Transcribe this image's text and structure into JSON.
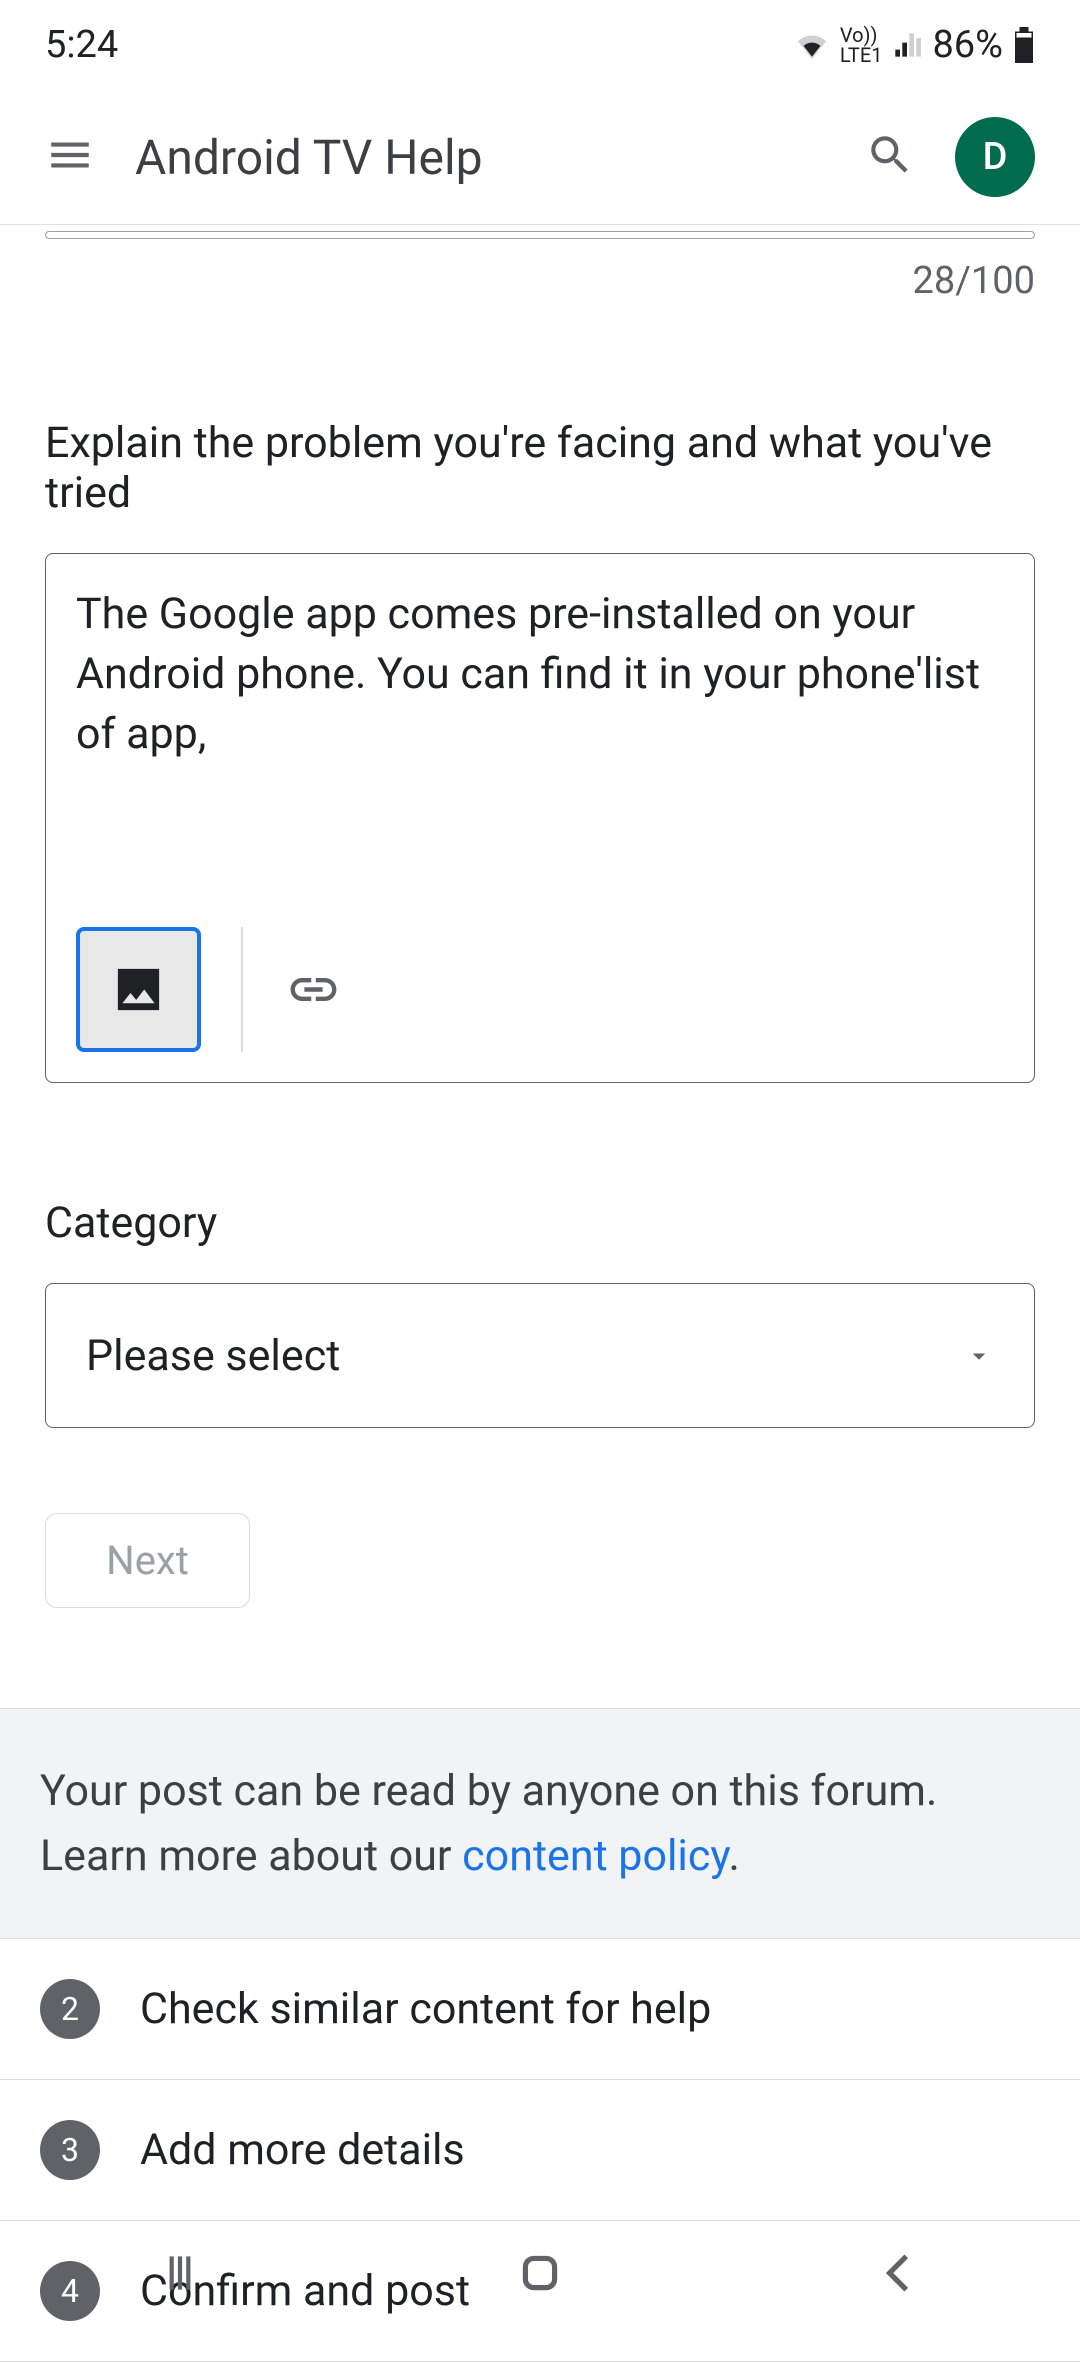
{
  "status": {
    "time": "5:24",
    "battery": "86%",
    "network": "LTE1",
    "volte": "Vo))"
  },
  "header": {
    "title": "Android TV Help",
    "avatar_initial": "D"
  },
  "form": {
    "char_count": "28/100",
    "explain_label": "Explain the problem you're facing and what you've tried",
    "explain_value": "The Google app comes pre-installed on your Android phone. You can find it in your phone'list of app,",
    "category_label": "Category",
    "category_value": "Please select",
    "next_label": "Next"
  },
  "notice": {
    "text_1": "Your post can be read by anyone on this forum. Learn more about our ",
    "link_text": "content policy",
    "text_2": "."
  },
  "steps": [
    {
      "num": "2",
      "label": "Check similar content for help"
    },
    {
      "num": "3",
      "label": "Add more details"
    },
    {
      "num": "4",
      "label": "Confirm and post"
    }
  ]
}
